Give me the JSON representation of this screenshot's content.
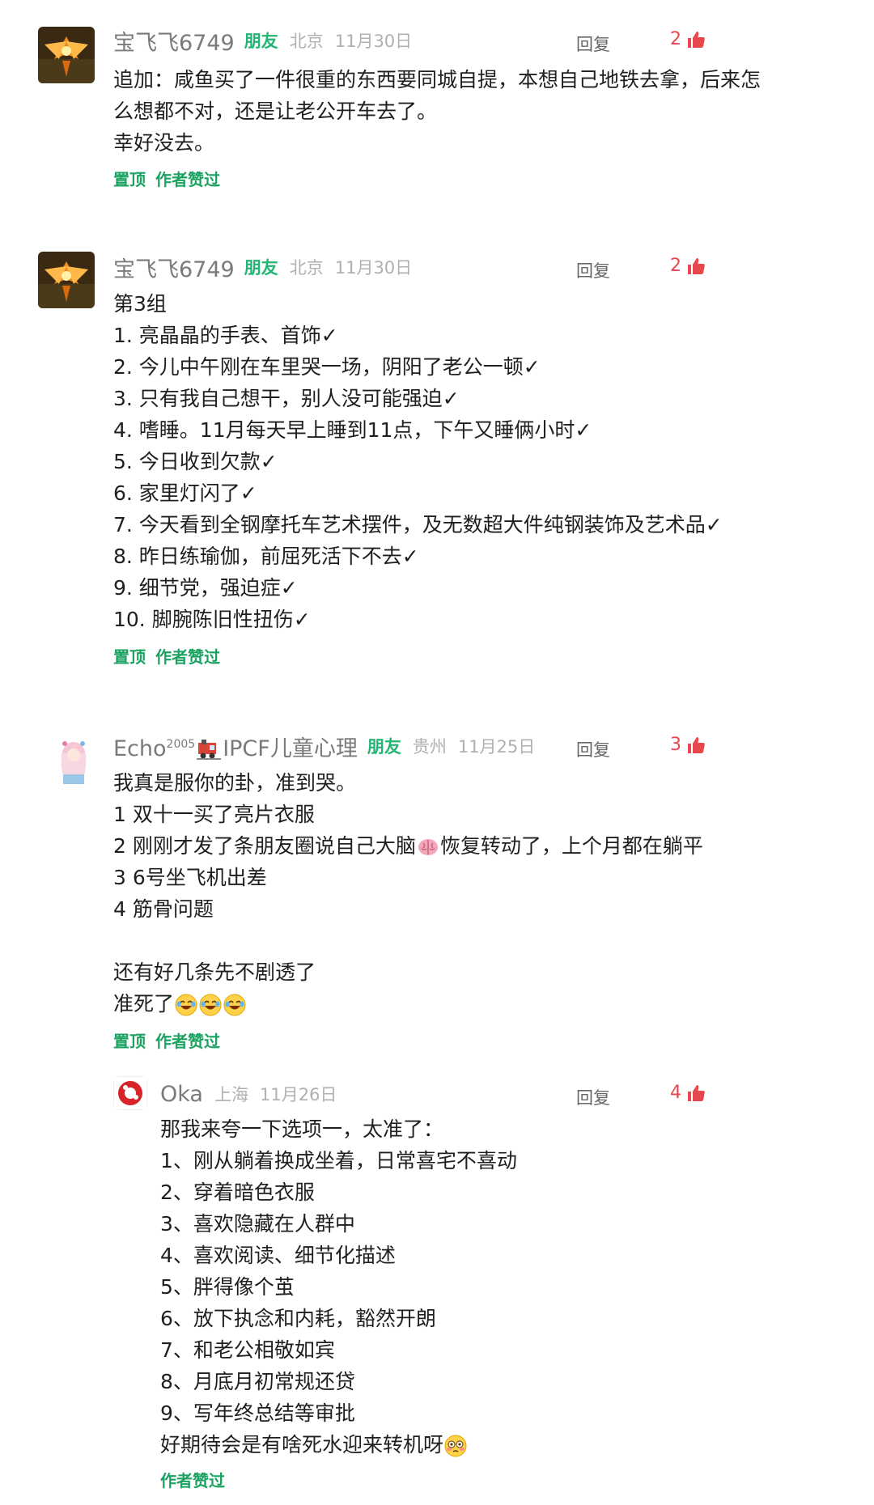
{
  "ui": {
    "reply_label": "回复",
    "friend_label": "朋友",
    "pin_label": "置顶",
    "author_liked_label": "作者赞过"
  },
  "comments": [
    {
      "username": "宝飞飞6749",
      "location": "北京",
      "date": "11月30日",
      "likes": "2",
      "lines": [
        "追加：咸鱼买了一件很重的东西要同城自提，本想自己地铁去拿，后来怎",
        "么想都不对，还是让老公开车去了。",
        "幸好没去。"
      ]
    },
    {
      "username": "宝飞飞6749",
      "location": "北京",
      "date": "11月30日",
      "likes": "2",
      "lines": [
        "第3组",
        "1. 亮晶晶的手表、首饰✓",
        "2. 今儿中午刚在车里哭一场，阴阳了老公一顿✓",
        "3. 只有我自己想干，别人没可能强迫✓",
        "4. 嗜睡。11月每天早上睡到11点，下午又睡俩小时✓",
        "5. 今日收到欠款✓",
        "6. 家里灯闪了✓",
        "7. 今天看到全钢摩托车艺术摆件，及无数超大件纯钢装饰及艺术品✓",
        "8. 昨日练瑜伽，前屈死活下不去✓",
        "9. 细节党，强迫症✓",
        "10. 脚腕陈旧性扭伤✓"
      ]
    },
    {
      "username_pre": "Echo",
      "username_sup": "2005",
      "username_post": "IPCF儿童心理",
      "location": "贵州",
      "date": "11月25日",
      "likes": "3",
      "lines": [
        "我真是服你的卦，准到哭。",
        "1 双十一买了亮片衣服",
        "3 6号坐飞机出差",
        "4 筋骨问题",
        "",
        "还有好几条先不剧透了"
      ],
      "line2_pre": "2 刚刚才发了条朋友圈说自己大脑",
      "line2_post": "恢复转动了，上个月都在躺平",
      "last_line": "准死了"
    },
    {
      "username": "Oka",
      "location": "上海",
      "date": "11月26日",
      "likes": "4",
      "lines": [
        "那我来夸一下选项一，太准了：",
        "1、刚从躺着换成坐着，日常喜宅不喜动",
        "2、穿着暗色衣服",
        "3、喜欢隐藏在人群中",
        "4、喜欢阅读、细节化描述",
        "5、胖得像个茧",
        "6、放下执念和内耗，豁然开朗",
        "7、和老公相敬如宾",
        "8、月底月初常规还贷",
        "9、写年终总结等审批"
      ],
      "last_line": "好期待会是有啥死水迎来转机呀"
    }
  ]
}
